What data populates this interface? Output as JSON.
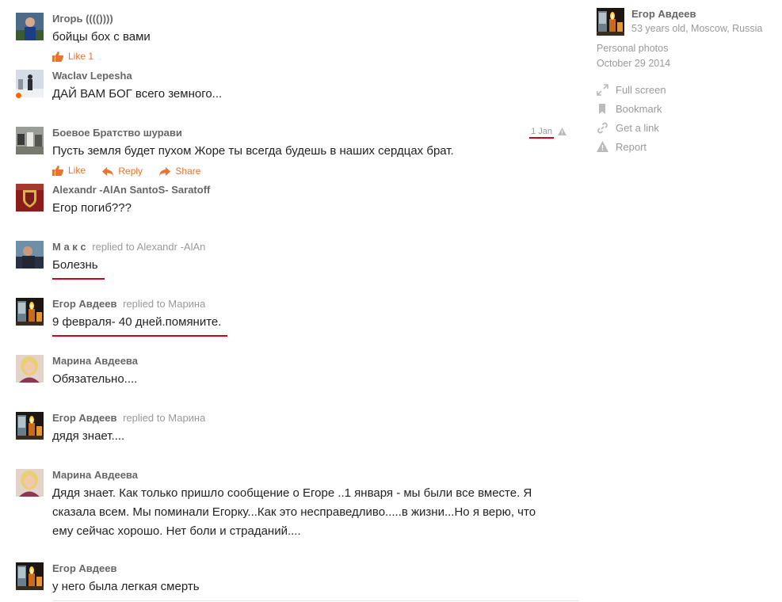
{
  "comments": [
    {
      "author": "Игорь (((())))",
      "text": "бойцы бох с вами",
      "like_label": "Like 1"
    },
    {
      "author": "Waclav Lepesha",
      "text": "ДАЙ ВАМ БОГ  всего земного..."
    },
    {
      "author": "Боевое Братство шурави",
      "text": "Пусть земля будет пухом Жоре ты всегда будешь в наших сердцах брат.",
      "date": "1 Jan",
      "like_label": "Like",
      "reply_label": "Reply",
      "share_label": "Share"
    },
    {
      "author": "Alexandr -AlAn SantoS- Saratoff",
      "text": "Егор погиб???"
    },
    {
      "author": "М а к с",
      "replied_to_label": "replied to",
      "replied_to": "Alexandr -AlAn",
      "text": "Болезнь"
    },
    {
      "author": "Егор Авдеев",
      "replied_to_label": "replied to",
      "replied_to": "Марина",
      "text": "9 февраля- 40 дней.помяните."
    },
    {
      "author": "Марина Авдеева",
      "text": "Обязательно...."
    },
    {
      "author": "Егор Авдеев",
      "replied_to_label": "replied to",
      "replied_to": "Марина",
      "text": "дядя знает...."
    },
    {
      "author": "Марина Авдеева",
      "text_lines": [
        "Дядя знает. Как только пришло сообщение о Егоре ..1 января - мы были все вместе. Я",
        "сказала всем. Мы поминали Егорку...Как это несправедливо.....в жизни...Но я верю, что",
        "ему сейчас хорошо. Нет боли и страданий...."
      ]
    },
    {
      "author": "Егор Авдеев",
      "text": "у него была легкая смерть"
    }
  ],
  "sidebar": {
    "owner_name": "Егор Авдеев",
    "owner_info": "53 years old, Moscow, Russia",
    "album": "Personal photos",
    "date": "October 29 2014",
    "links": {
      "full_screen": "Full screen",
      "bookmark": "Bookmark",
      "get_link": "Get a link",
      "report": "Report"
    }
  },
  "colors": {
    "accent": "#eb722e",
    "annotation_red": "#d0021b",
    "author": "#666666",
    "muted": "#999999"
  }
}
